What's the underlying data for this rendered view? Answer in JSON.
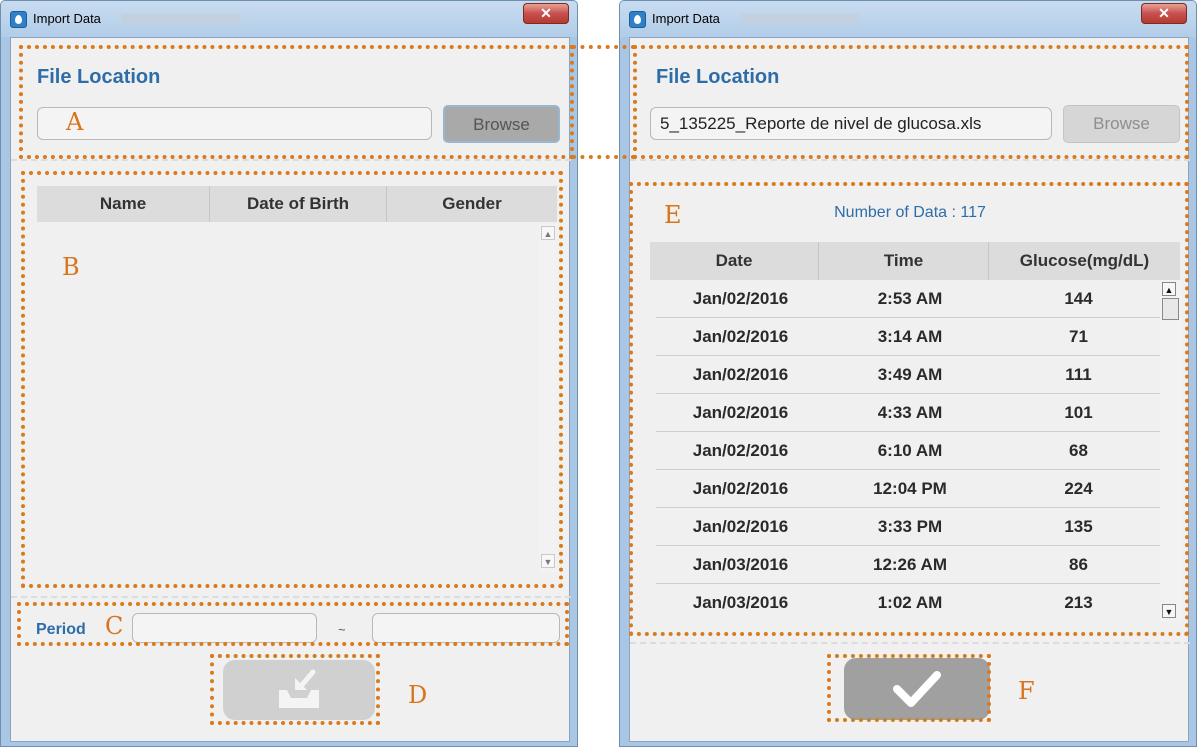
{
  "left_window": {
    "title": "Import Data",
    "close_glyph": "✕",
    "file_location_heading": "File Location",
    "file_path_value": "",
    "browse_label": "Browse",
    "patient_table": {
      "headers": [
        "Name",
        "Date of Birth",
        "Gender"
      ],
      "rows": []
    },
    "period_label": "Period",
    "period_start_value": "",
    "period_separator": "~",
    "period_end_value": "",
    "import_button_icon": "inbox-import-icon"
  },
  "right_window": {
    "title": "Import Data",
    "close_glyph": "✕",
    "file_location_heading": "File Location",
    "file_path_value": "5_135225_Reporte de nivel de glucosa.xls",
    "browse_label": "Browse",
    "data_count_text": "Number of Data : 117",
    "data_table": {
      "headers": [
        "Date",
        "Time",
        "Glucose(mg/dL)"
      ],
      "rows": [
        [
          "Jan/02/2016",
          "2:53 AM",
          "144"
        ],
        [
          "Jan/02/2016",
          "3:14 AM",
          "71"
        ],
        [
          "Jan/02/2016",
          "3:49 AM",
          "111"
        ],
        [
          "Jan/02/2016",
          "4:33 AM",
          "101"
        ],
        [
          "Jan/02/2016",
          "6:10 AM",
          "68"
        ],
        [
          "Jan/02/2016",
          "12:04 PM",
          "224"
        ],
        [
          "Jan/02/2016",
          "3:33 PM",
          "135"
        ],
        [
          "Jan/03/2016",
          "12:26 AM",
          "86"
        ],
        [
          "Jan/03/2016",
          "1:02 AM",
          "213"
        ]
      ]
    },
    "confirm_button_icon": "checkmark-icon"
  },
  "callouts": {
    "a": "A",
    "b": "B",
    "c": "C",
    "d": "D",
    "e": "E",
    "f": "F"
  },
  "colors": {
    "accent_text": "#2e6da8",
    "callout": "#d97a1e",
    "window_frame": "#a9c6e4",
    "client_bg": "#f0f0f0"
  }
}
